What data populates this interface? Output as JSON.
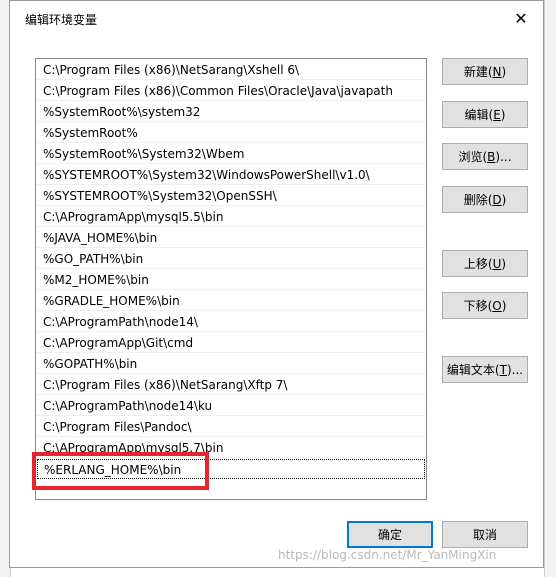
{
  "dialog": {
    "title": "编辑环境变量",
    "close_glyph": "✕"
  },
  "paths": [
    "C:\\Program Files (x86)\\NetSarang\\Xshell 6\\",
    "C:\\Program Files (x86)\\Common Files\\Oracle\\Java\\javapath",
    "%SystemRoot%\\system32",
    "%SystemRoot%",
    "%SystemRoot%\\System32\\Wbem",
    "%SYSTEMROOT%\\System32\\WindowsPowerShell\\v1.0\\",
    "%SYSTEMROOT%\\System32\\OpenSSH\\",
    "C:\\AProgramApp\\mysql5.5\\bin",
    "%JAVA_HOME%\\bin",
    "%GO_PATH%\\bin",
    "%M2_HOME%\\bin",
    "%GRADLE_HOME%\\bin",
    "C:\\AProgramPath\\node14\\",
    "C:\\AProgramApp\\Git\\cmd",
    "%GOPATH%\\bin",
    "C:\\Program Files (x86)\\NetSarang\\Xftp 7\\",
    "C:\\AProgramPath\\node14\\ku",
    "C:\\Program Files\\Pandoc\\",
    "C:\\AProgramApp\\mysql5.7\\bin"
  ],
  "editing_value": "%ERLANG_HOME%\\bin",
  "buttons": {
    "new": {
      "text": "新建(",
      "key": "N",
      "end": ")"
    },
    "edit": {
      "text": "编辑(",
      "key": "E",
      "end": ")"
    },
    "browse": {
      "text": "浏览(",
      "key": "B",
      "end": ")..."
    },
    "delete": {
      "text": "删除(",
      "key": "D",
      "end": ")"
    },
    "move_up": {
      "text": "上移(",
      "key": "U",
      "end": ")"
    },
    "move_down": {
      "text": "下移(",
      "key": "O",
      "end": ")"
    },
    "edit_text": {
      "text": "编辑文本(",
      "key": "T",
      "end": ")..."
    },
    "ok": "确定",
    "cancel": "取消"
  },
  "watermark": "https://blog.csdn.net/Mr_YanMingXin"
}
